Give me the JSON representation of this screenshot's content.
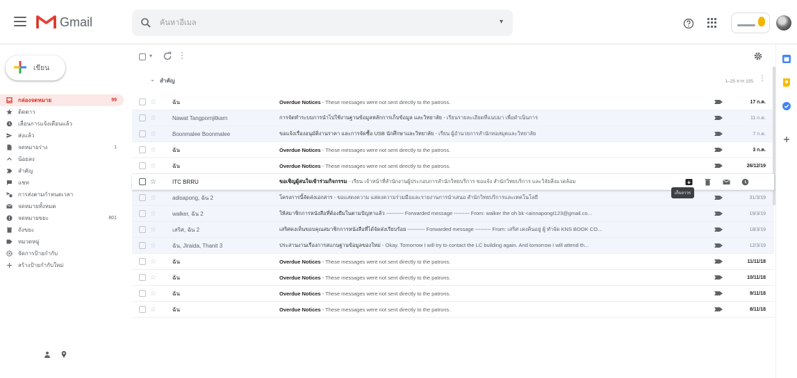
{
  "header": {
    "brand": "Gmail",
    "search_placeholder": "ค้นหาอีเมล"
  },
  "compose": {
    "label": "เขียน"
  },
  "nav": [
    {
      "label": "กล่องจดหมาย",
      "count": "99",
      "icon": "inbox-icon",
      "active": true
    },
    {
      "label": "ติดดาว",
      "count": "",
      "icon": "star-icon"
    },
    {
      "label": "เลื่อนการแจ้งเตือนแล้ว",
      "count": "",
      "icon": "clock-icon"
    },
    {
      "label": "ส่งแล้ว",
      "count": "",
      "icon": "send-icon"
    },
    {
      "label": "จดหมายร่าง",
      "count": "1",
      "icon": "draft-icon"
    },
    {
      "label": "น้อยลง",
      "count": "",
      "icon": "chevron-up-icon"
    },
    {
      "label": "สำคัญ",
      "count": "",
      "icon": "label-important-icon"
    },
    {
      "label": "แชท",
      "count": "",
      "icon": "chat-icon"
    },
    {
      "label": "การส่งตามกำหนดเวลา",
      "count": "",
      "icon": "scheduled-send-icon"
    },
    {
      "label": "จดหมายทั้งหมด",
      "count": "",
      "icon": "all-mail-icon"
    },
    {
      "label": "จดหมายขยะ",
      "count": "801",
      "icon": "spam-icon"
    },
    {
      "label": "ถังขยะ",
      "count": "",
      "icon": "trash-icon"
    },
    {
      "label": "หมวดหมู่",
      "count": "",
      "icon": "category-icon"
    },
    {
      "label": "จัดการป้ายกำกับ",
      "count": "",
      "icon": "manage-labels-icon"
    },
    {
      "label": "สร้างป้ายกำกับใหม่",
      "count": "",
      "icon": "create-label-icon"
    }
  ],
  "section": {
    "title": "สำคัญ",
    "range": "1–25 จาก 155"
  },
  "tooltip": "เก็บถาวร",
  "messages": [
    {
      "sender": "ฉัน",
      "subject": "Overdue Notices",
      "snippet": " - These messages were not sent directly to the patrons.",
      "date": "17 ก.ค.",
      "read": false
    },
    {
      "sender": "Nawat Tangpornjitkarn",
      "subject": "การจัดทำระบบการนำไปใช้งานฐานข้อมูลหลักการเก็บข้อมูล และวิทยาลัย",
      "snippet": " - เรียนรายละเอียดที่แนบมา เพื่อดำเนินการ",
      "date": "11 ก.ค.",
      "read": true
    },
    {
      "sender": "Boonmalee Boonmalee",
      "subject": "ขอแจ้งเรื่องอนุมัติงานราคา และการจัดซื้อ USB นักศึกษาและวิทยาลัย",
      "snippet": " - เรียน ผู้อำนวยการสำนักหอสมุดและวิทยาลัย",
      "date": "7 ก.ค.",
      "read": true
    },
    {
      "sender": "ฉัน",
      "subject": "Overdue Notices",
      "snippet": " - These messages were not sent directly to the patrons.",
      "date": "3 ก.ค.",
      "read": false
    },
    {
      "sender": "ฉัน",
      "subject": "Overdue Notices",
      "snippet": " - These messages were not sent directly to the patrons.",
      "date": "26/12/19",
      "read": false
    },
    {
      "sender": "ITC BRRU",
      "subject": "ขอเชิญผู้สนใจเข้าร่วมกิจกรรม",
      "snippet": " - เรียน เจ้าหน้าที่สำนักงานผู้ประกอบการสำนักวิทยบริการ ขอแจ้ง สำนักวิทยบริการ และวิจัยสิ่งแวดล้อม",
      "date": "",
      "read": false,
      "hover": true
    },
    {
      "sender": "adisapong, ฉัน 2",
      "subject": "โครงการนี้จัดส่งเอกสาร",
      "snippet": " - ขอแสดงความ แสดงความร่วมมือและรายงานการนำเสนอ สำนักวิทยบริการและเทคโนโลยี",
      "date": "31/3/19",
      "read": true
    },
    {
      "sender": "walker, ฉัน 2",
      "subject": "ให้สมาชิกการหนังสือที่ต้องยืมในตามปัญหาแล้ว",
      "snippet": " ---------- Forwarded message --------- From: walker the oh bk <ainnapongt123@gmail.co...",
      "date": "19/3/19",
      "read": true
    },
    {
      "sender": "เสริศ, ฉัน 2",
      "subject": "เสริศคงเห็นขอบคุณสมาชิกการหนังสือที่ได้จัดส่งเรียบร้อย",
      "snippet": " ---------- Forwarded message --------- From: เสริศ เคงคินอยู่ ผู้ ทำจัด KNS BOOK CO...",
      "date": "18/3/19",
      "read": true
    },
    {
      "sender": "ฉัน, Jiraida, Thanit 3",
      "subject": "ประสานงานเรื่องการสแกนฐานข้อมูลของใหม่",
      "snippet": " - Okay. Tomorrow I will try to contact the LC building again. And tomorrow I will attend th...",
      "date": "12/3/19",
      "read": true
    },
    {
      "sender": "ฉัน",
      "subject": "Overdue Notices",
      "snippet": " - These messages were not sent directly to the patrons.",
      "date": "11/11/18",
      "read": false
    },
    {
      "sender": "ฉัน",
      "subject": "Overdue Notices",
      "snippet": " - These messages were not sent directly to the patrons.",
      "date": "10/11/18",
      "read": false
    },
    {
      "sender": "ฉัน",
      "subject": "Overdue Notices",
      "snippet": " - These messages were not sent directly to the patrons.",
      "date": "9/11/18",
      "read": false
    },
    {
      "sender": "ฉัน",
      "subject": "Overdue Notices",
      "snippet": " - These messages were not sent directly to the patrons.",
      "date": "8/11/18",
      "read": false
    }
  ],
  "colors": {
    "gmail_red": "#d93025",
    "active_bg": "#fce8e6",
    "read_row_bg": "#f2f6fc",
    "tag_yellow": "#f4b400"
  }
}
